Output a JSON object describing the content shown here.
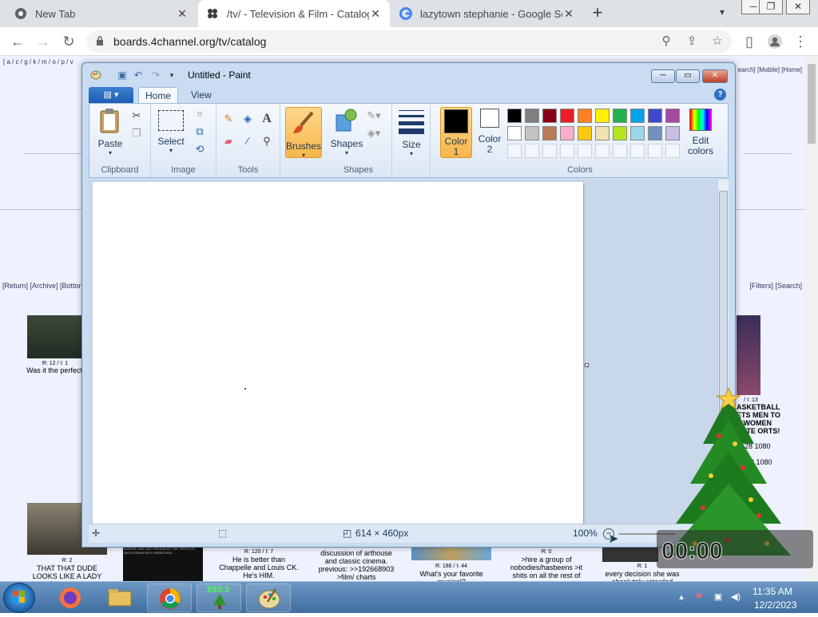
{
  "browser": {
    "tabs": [
      {
        "label": "New Tab",
        "icon": "chrome-icon",
        "active": false
      },
      {
        "label": "/tv/ - Television & Film - Catalog",
        "icon": "4chan-icon",
        "active": true
      },
      {
        "label": "lazytown stephanie - Google Search",
        "icon": "google-icon",
        "active": false
      }
    ],
    "url": "boards.4channel.org/tv/catalog"
  },
  "page": {
    "boardlist": "[ a / c / g / k / m / o / p / v",
    "boardlist_right": "earch] [Mobile] [Home]",
    "nav_left": "[Return] [Archive] [Botton",
    "nav_right": "[Filters] [Search]",
    "threads": [
      {
        "stats": "R: 12 / I: 1",
        "teaser": "Was it the perfect"
      },
      {
        "stats": "R: 2",
        "teaser": "THAT THAT DUDE LOOKS LIKE A LADY"
      },
      {
        "stats": "",
        "teaser": "MARVEL HAS JUST REVEALED THE TRUTH OF NIGHTCRAWLER'S PARENTAGE"
      },
      {
        "stats": "R: 120 / I: 7",
        "teaser": "He is better than Chappelle and Louis CK. He's HIM."
      },
      {
        "stats": "",
        "teaser": "discussion of arthouse and classic cinema. previous: >>192668903 >film/ charts"
      },
      {
        "stats": "R: 186 / I: 44",
        "teaser": "What's your favorite musical?"
      },
      {
        "stats": "R: 0",
        "teaser": ">hire a group of nobodies/hasbeens >it shits on all the rest of"
      },
      {
        "stats": "R: 1",
        "teaser": "every decision she was absolutely retarded"
      },
      {
        "stats": "/ I: 13",
        "teaser": "ASKETBALL ETS MEN TO E WOMEN NATE ORTS!"
      },
      {
        "stats": "",
        "teaser": "28 1080"
      },
      {
        "stats": "",
        "teaser": "TH 1080"
      }
    ]
  },
  "paint": {
    "title": "Untitled - Paint",
    "tabs": [
      "Home",
      "View"
    ],
    "groups": {
      "clipboard": "Clipboard",
      "image": "Image",
      "tools": "Tools",
      "shapes": "Shapes",
      "colors": "Colors"
    },
    "buttons": {
      "paste": "Paste",
      "select": "Select",
      "brushes": "Brushes",
      "shapes": "Shapes",
      "size": "Size",
      "color1": "Color 1",
      "color2": "Color 2",
      "edit_colors": "Edit colors"
    },
    "palette_row1": [
      "#000000",
      "#7f7f7f",
      "#880015",
      "#ed1c24",
      "#ff7f27",
      "#fff200",
      "#22b14c",
      "#00a2e8",
      "#3f48cc",
      "#a349a4"
    ],
    "palette_row2": [
      "#ffffff",
      "#c3c3c3",
      "#b97a57",
      "#ffaec9",
      "#ffc90e",
      "#efe4b0",
      "#b5e61d",
      "#99d9ea",
      "#7092be",
      "#c8bfe7"
    ],
    "color1": "#000000",
    "color2": "#ffffff",
    "status": {
      "canvas_size": "614 × 460px",
      "zoom": "100%"
    }
  },
  "xmas_widget": {
    "counter": "293:3"
  },
  "taskbar": {
    "apps": [
      "start",
      "firefox",
      "file-explorer",
      "chrome",
      "xmas-tree-app",
      "paint"
    ],
    "time": "11:35 AM",
    "date": "12/2/2023"
  }
}
